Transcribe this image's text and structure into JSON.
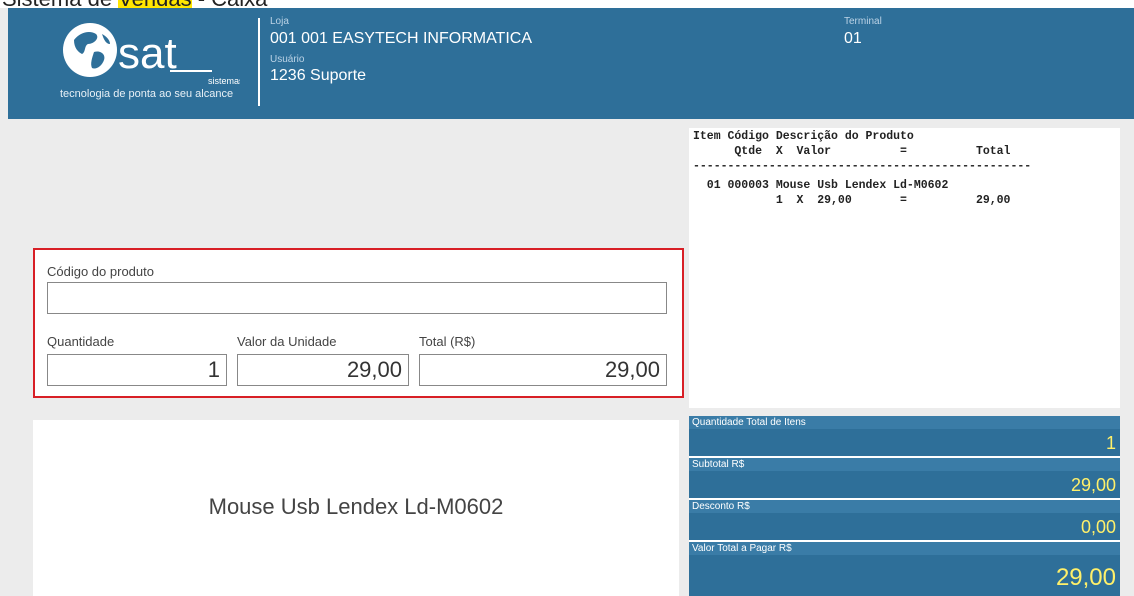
{
  "top_strip": {
    "text_before": "Sistema de ",
    "highlight": "Vendas",
    "text_after": " - Caixa"
  },
  "header": {
    "brand": "sat",
    "brand_sub": "sistemas",
    "tagline": "tecnologia de ponta ao seu alcance",
    "loja_label": "Loja",
    "loja_value": "001 001 EASYTECH INFORMATICA",
    "usuario_label": "Usuário",
    "usuario_value": "1236 Suporte",
    "terminal_label": "Terminal",
    "terminal_value": "01"
  },
  "input_panel": {
    "codigo_label": "Código do produto",
    "codigo_value": "",
    "quantidade_label": "Quantidade",
    "quantidade_value": "1",
    "valor_unidade_label": "Valor da Unidade",
    "valor_unidade_value": "29,00",
    "total_label": "Total (R$)",
    "total_value": "29,00"
  },
  "product_display": {
    "name": "Mouse Usb Lendex Ld-M0602"
  },
  "receipt": {
    "header_line1": "Item Código Descrição do Produto",
    "header_line2": "      Qtde  X  Valor          =          Total",
    "divider": "-------------------------------------------------",
    "item_line1": "  01 000003 Mouse Usb Lendex Ld-M0602",
    "item_line2": "            1  X  29,00       =          29,00"
  },
  "totals": {
    "qtd_label": "Quantidade Total de Itens",
    "qtd_value": "1",
    "subtotal_label": "Subtotal R$",
    "subtotal_value": "29,00",
    "desconto_label": "Desconto R$",
    "desconto_value": "0,00",
    "total_label": "Valor Total a Pagar R$",
    "total_value": "29,00"
  },
  "colors": {
    "header_bg": "#2e6f99",
    "value_yellow": "#fff06a",
    "panel_border": "#d81f26"
  }
}
